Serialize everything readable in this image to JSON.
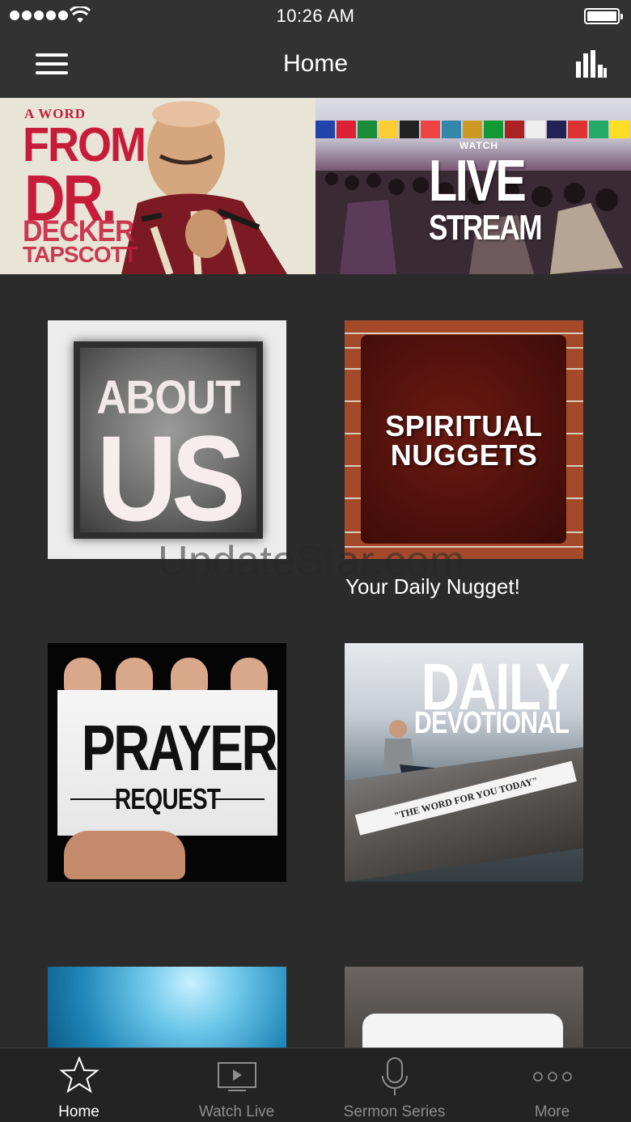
{
  "status_bar": {
    "time": "10:26 AM"
  },
  "nav": {
    "title": "Home"
  },
  "banner": {
    "left": {
      "line1": "A WORD",
      "line2": "FROM",
      "line3": "DR.",
      "line4": "DECKER",
      "line5": "TAPSCOTT"
    },
    "right": {
      "line1": "WATCH",
      "line2": "LIVE",
      "line3": "STREAM"
    }
  },
  "tiles": {
    "about": {
      "line1": "ABOUT",
      "line2": "US"
    },
    "nuggets": {
      "line1": "SPIRITUAL",
      "line2": "NUGGETS",
      "caption": "Your Daily Nugget!"
    },
    "prayer": {
      "line1": "PRAYER",
      "line2": "REQUEST"
    },
    "devotional": {
      "line1": "DAILY",
      "line2": "DEVOTIONAL",
      "strip": "\"THE WORD FOR YOU TODAY\""
    }
  },
  "watermark": "UpdateStar.com",
  "tab_bar": {
    "tabs": [
      {
        "label": "Home",
        "icon": "star-icon",
        "active": true
      },
      {
        "label": "Watch Live",
        "icon": "tv-play-icon",
        "active": false
      },
      {
        "label": "Sermon Series",
        "icon": "microphone-icon",
        "active": false
      },
      {
        "label": "More",
        "icon": "more-dots-icon",
        "active": false
      }
    ]
  },
  "colors": {
    "background": "#2b2b2b",
    "bars": "#323232",
    "tab_active": "#ffffff",
    "tab_inactive": "#8d8d8d",
    "banner_red": "#c61c3a"
  }
}
